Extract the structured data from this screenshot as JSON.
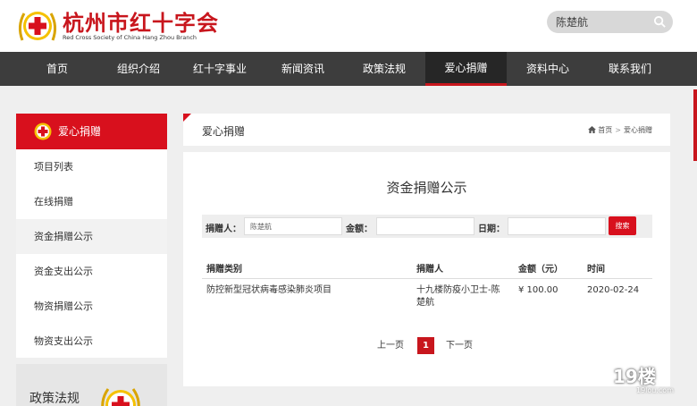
{
  "brand": {
    "title": "杭州市红十字会",
    "subtitle": "Red Cross Society of China Hang Zhou Branch",
    "accent": "#c8161d"
  },
  "search": {
    "value": "陈楚航",
    "icon": "search-icon"
  },
  "nav": {
    "items": [
      {
        "label": "首页"
      },
      {
        "label": "组织介绍"
      },
      {
        "label": "红十字事业"
      },
      {
        "label": "新闻资讯"
      },
      {
        "label": "政策法规"
      },
      {
        "label": "爱心捐赠"
      },
      {
        "label": "资料中心"
      },
      {
        "label": "联系我们"
      }
    ],
    "active": "爱心捐赠"
  },
  "sidebar": {
    "title": "爱心捐赠",
    "items": [
      {
        "label": "项目列表"
      },
      {
        "label": "在线捐赠"
      },
      {
        "label": "资金捐赠公示"
      },
      {
        "label": "资金支出公示"
      },
      {
        "label": "物资捐赠公示"
      },
      {
        "label": "物资支出公示"
      }
    ],
    "active": "资金捐赠公示",
    "policy_title": "政策法规"
  },
  "breadcrumb": {
    "section_title": "爱心捐赠",
    "home": "首页",
    "separator": ">",
    "current": "爱心捐赠"
  },
  "content": {
    "title": "资金捐赠公示",
    "filter": {
      "donor_label": "捐赠人：",
      "donor_value": "陈楚航",
      "amount_label": "金额：",
      "amount_value": "",
      "date_label": "日期：",
      "date_value": "",
      "search_button": "搜索"
    },
    "table": {
      "headers": [
        "捐赠类别",
        "捐赠人",
        "金额（元）",
        "时间"
      ],
      "rows": [
        [
          "防控新型冠状病毒感染肺炎项目",
          "十九楼防疫小卫士-陈楚航",
          "¥ 100.00",
          "2020-02-24"
        ]
      ]
    },
    "pagination": {
      "prev": "上一页",
      "current": "1",
      "next": "下一页"
    }
  },
  "watermark": {
    "text": "19楼",
    "sub": "19lou.com"
  }
}
